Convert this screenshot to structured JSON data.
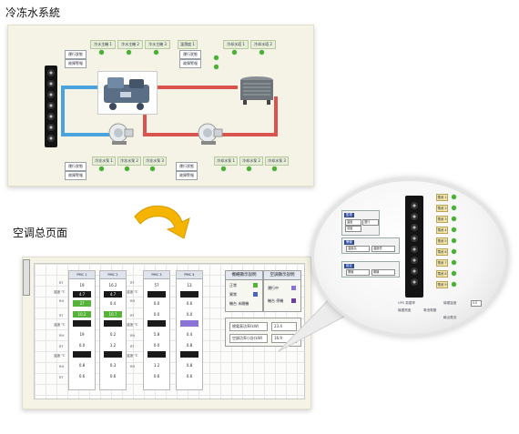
{
  "titles": {
    "chilled_water": "冷冻水系統",
    "hvac_overview": "空调总页面"
  },
  "chiller_panel": {
    "top_tags": [
      "冷水主機 1",
      "冷水主機 2",
      "冷水主機 3",
      "溫濕度 1",
      "冷却水塔 1",
      "冷却水塔 2"
    ],
    "left_tags": [
      "運行狀態",
      "故障警報"
    ],
    "right_tags": [
      "運行狀態",
      "故障警報"
    ],
    "bottom_tags": [
      "冷冻水泵 1",
      "冷冻水泵 2",
      "冷冻水泵 3",
      "冷却水泵 1",
      "冷却水泵 2",
      "冷却水泵 3"
    ],
    "bottom_left_tags": [
      "運行狀態",
      "故障警報"
    ],
    "bottom_mid_tags": [
      "運行狀態",
      "故障警報"
    ]
  },
  "hvac_panel": {
    "columns": [
      {
        "header": "PMC 1",
        "cells": [
          {
            "v": "19",
            "s": "plain"
          },
          {
            "v": "4.7",
            "s": "dark"
          },
          {
            "v": "27",
            "s": "green"
          },
          {
            "v": "10.2",
            "s": "green"
          },
          {
            "v": "",
            "s": "dark"
          },
          {
            "v": "19",
            "s": "plain"
          },
          {
            "v": "0.0",
            "s": "plain"
          },
          {
            "v": "",
            "s": "dark"
          },
          {
            "v": "0.8",
            "s": "plain"
          },
          {
            "v": "0.6",
            "s": "plain"
          }
        ]
      },
      {
        "header": "PMC 2",
        "cells": [
          {
            "v": "16.2",
            "s": "plain"
          },
          {
            "v": "4.7",
            "s": "dark"
          },
          {
            "v": "0.4",
            "s": "plain"
          },
          {
            "v": "10.7",
            "s": "green"
          },
          {
            "v": "",
            "s": "dark"
          },
          {
            "v": "0.2",
            "s": "plain"
          },
          {
            "v": "1.2",
            "s": "plain"
          },
          {
            "v": "",
            "s": "dark"
          },
          {
            "v": "0.3",
            "s": "plain"
          },
          {
            "v": "0.6",
            "s": "plain"
          }
        ]
      },
      {
        "header": "PMC 3",
        "cells": [
          {
            "v": "57",
            "s": "plain"
          },
          {
            "v": "",
            "s": "dark"
          },
          {
            "v": "0.0",
            "s": "plain"
          },
          {
            "v": "0.0",
            "s": "plain"
          },
          {
            "v": "",
            "s": "dark"
          },
          {
            "v": "5.8",
            "s": "plain"
          },
          {
            "v": "0.0",
            "s": "plain"
          },
          {
            "v": "",
            "s": "dark"
          },
          {
            "v": "1.2",
            "s": "plain"
          },
          {
            "v": "0.6",
            "s": "plain"
          }
        ]
      },
      {
        "header": "PMC 4",
        "cells": [
          {
            "v": "13",
            "s": "plain"
          },
          {
            "v": "",
            "s": "dark"
          },
          {
            "v": "0.6",
            "s": "plain"
          },
          {
            "v": "0.0",
            "s": "plain"
          },
          {
            "v": "",
            "s": "purple"
          },
          {
            "v": "0.4",
            "s": "plain"
          },
          {
            "v": "0.8",
            "s": "plain"
          },
          {
            "v": "",
            "s": "dark"
          },
          {
            "v": "0.8",
            "s": "plain"
          },
          {
            "v": "0.6",
            "s": "plain"
          }
        ]
      }
    ],
    "row_labels_left": [
      "RT",
      "溫度 ℃",
      "RH",
      "RT",
      "溫度 ℃",
      "RH",
      "RT",
      "溫度 ℃",
      "RH",
      "RT"
    ],
    "row_labels_mid": [
      "RT",
      "溫度 ℃",
      "RH",
      "RT",
      "溫度 ℃",
      "RH",
      "RT",
      "溫度 ℃",
      "RH"
    ],
    "legend_left": {
      "title": "機櫃顯示說明",
      "rows": [
        "正常",
        "異常",
        "機台 未開機"
      ]
    },
    "legend_right": {
      "title": "空調顯示說明",
      "rows": [
        "運行中",
        "機台 停機"
      ]
    },
    "power_rows": [
      {
        "label": "總電表功率(kW)",
        "value": "23.4"
      },
      {
        "label": "空調功率小計(kW)",
        "value": "16.9"
      }
    ]
  },
  "zoom_panel": {
    "box1_title": "監視",
    "box1_rows": [
      "溫度",
      "濕度",
      "運行"
    ],
    "box2_title": "警報",
    "box2_rows": [
      "溫度高",
      "溫度低"
    ],
    "box3_title": "設定",
    "box3_rows": [
      "開機",
      "關機"
    ],
    "units": [
      "電池 1",
      "電池 2",
      "電池 3",
      "電池 4",
      "電池 5",
      "電池 6",
      "電池 7",
      "電池 8",
      "電池 9"
    ],
    "bottom_labels": [
      "UPS 負載率",
      "機櫃溫度",
      "機櫃濕度",
      "電池電壓",
      "輸出電流"
    ],
    "bottom_value": "0.0"
  },
  "colors": {
    "supply_pipe": "#4aa3dc",
    "return_pipe": "#d9534f",
    "status_led": "#4caf2e"
  }
}
